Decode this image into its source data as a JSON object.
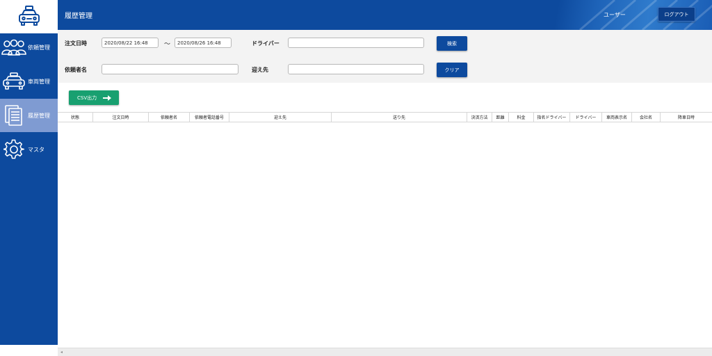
{
  "header": {
    "title": "履歴管理",
    "user_label": "ユーザー",
    "logout_label": "ログアウト"
  },
  "sidebar": {
    "logo_icon": "taxi-icon",
    "items": [
      {
        "label": "依頼管理",
        "icon": "users-icon"
      },
      {
        "label": "車両管理",
        "icon": "car-icon"
      },
      {
        "label": "履歴管理",
        "icon": "document-icon",
        "active": true
      },
      {
        "label": "マスタ",
        "icon": "gear-icon"
      }
    ]
  },
  "search": {
    "order_datetime_label": "注文日時",
    "order_from": "2020/08/22 16:48",
    "range_sep": "〜",
    "order_to": "2020/08/26 16:48",
    "driver_label": "ドライバー",
    "driver_value": "",
    "requester_label": "依頼者名",
    "requester_value": "",
    "pickup_label": "迎え先",
    "pickup_value": "",
    "search_button": "検索",
    "clear_button": "クリア"
  },
  "csv_button": "CSV出力",
  "table": {
    "columns": [
      "状態",
      "注文日時",
      "依頼者名",
      "依頼者電話番号",
      "迎え先",
      "送り先",
      "決済方法",
      "距離",
      "料金",
      "指名ドライバー",
      "ドライバー",
      "車両表示名",
      "会社名",
      "降車日時"
    ],
    "rows": []
  },
  "colors": {
    "primary": "#0d4a9e",
    "sidebar_active": "#7f9bd2",
    "csv_green": "#18a070",
    "panel_bg": "#f3f3f3"
  }
}
